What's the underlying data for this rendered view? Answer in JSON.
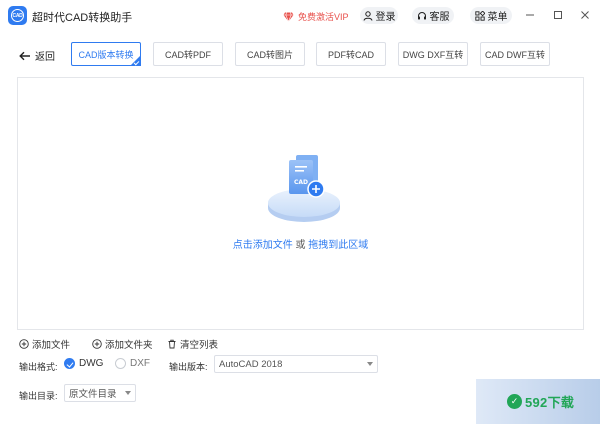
{
  "window": {
    "title": "超时代CAD转换助手",
    "logo_text": "CAD",
    "vip_label": "免费激活VIP",
    "login_label": "登录",
    "service_label": "客服",
    "menu_label": "菜单"
  },
  "nav": {
    "back_label": "返回",
    "tabs": [
      {
        "label": "CAD版本转换",
        "active": true
      },
      {
        "label": "CAD转PDF",
        "active": false
      },
      {
        "label": "CAD转图片",
        "active": false
      },
      {
        "label": "PDF转CAD",
        "active": false
      },
      {
        "label": "DWG DXF互转",
        "active": false
      },
      {
        "label": "CAD DWF互转",
        "active": false
      }
    ]
  },
  "drop_area": {
    "badge": "CAD",
    "click_text": "点击添加文件",
    "or_text": " 或 ",
    "drag_text": "拖拽到此区域"
  },
  "actions": {
    "add_file": "添加文件",
    "add_folder": "添加文件夹",
    "clear_list": "清空列表"
  },
  "options": {
    "format_label": "输出格式:",
    "formats": [
      {
        "label": "DWG",
        "selected": true
      },
      {
        "label": "DXF",
        "selected": false
      }
    ],
    "version_label": "输出版本:",
    "version_value": "AutoCAD 2018",
    "dir_label": "输出目录:",
    "dir_value": "原文件目录"
  },
  "watermark": {
    "text": "592下载",
    "mark": "✓"
  },
  "colors": {
    "accent": "#2f7bf0",
    "vip": "#e8504b",
    "watermark": "#21a657"
  }
}
